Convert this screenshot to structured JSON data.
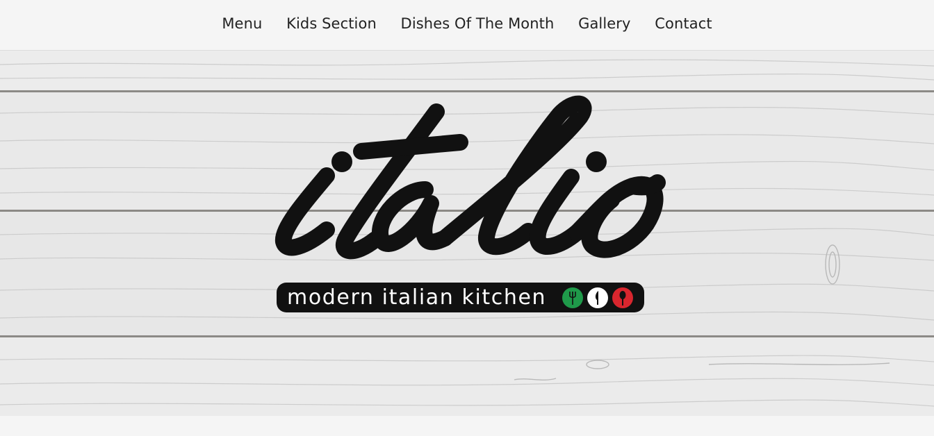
{
  "nav": {
    "items": [
      {
        "label": "Menu"
      },
      {
        "label": "Kids Section"
      },
      {
        "label": "Dishes Of The Month"
      },
      {
        "label": "Gallery"
      },
      {
        "label": "Contact"
      }
    ]
  },
  "hero": {
    "logo_wordmark": "italio",
    "tagline": "modern italian kitchen",
    "flag_icons": [
      {
        "name": "fork-icon",
        "color": "#1f9a4a"
      },
      {
        "name": "knife-icon",
        "color": "#ffffff"
      },
      {
        "name": "spoon-icon",
        "color": "#d8262e"
      }
    ]
  },
  "colors": {
    "nav_bg": "#f5f5f5",
    "nav_text": "#222222",
    "logo": "#111111",
    "wood": "#e6e6e6"
  }
}
